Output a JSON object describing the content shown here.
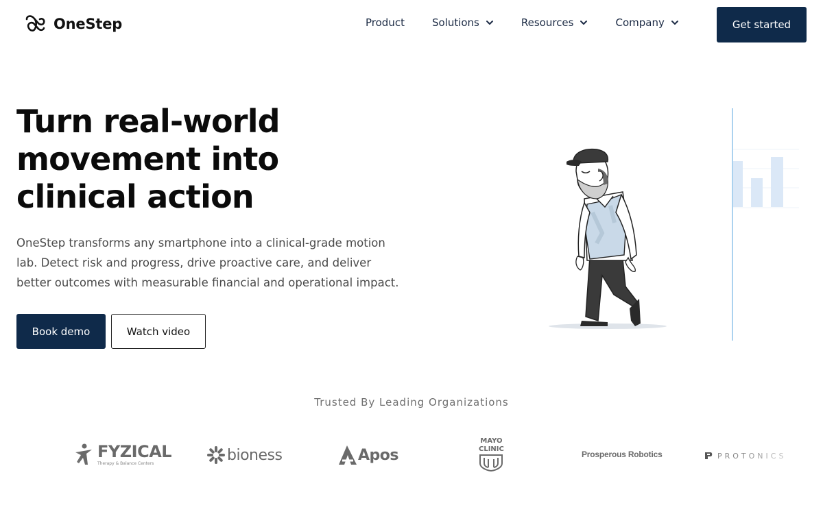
{
  "brand": {
    "name": "OneStep"
  },
  "nav": {
    "links": [
      {
        "label": "Product",
        "has_dropdown": false
      },
      {
        "label": "Solutions",
        "has_dropdown": true
      },
      {
        "label": "Resources",
        "has_dropdown": true
      },
      {
        "label": "Company",
        "has_dropdown": true
      }
    ],
    "cta_label": "Get started"
  },
  "hero": {
    "title_lines": [
      "Turn real-world",
      "movement into",
      "clinical action"
    ],
    "description": "OneStep transforms any smartphone into a clinical-grade motion lab. Detect risk and progress, drive proactive care, and deliver better outcomes with measurable financial and operational impact.",
    "primary_button": "Book demo",
    "secondary_button": "Watch video"
  },
  "trusted": {
    "heading": "Trusted By Leading Organizations",
    "logos": [
      {
        "name": "FYZICAL",
        "subtext": "Therapy & Balance Centers"
      },
      {
        "name": "bioness"
      },
      {
        "name": "Apos"
      },
      {
        "name": "MAYO CLINIC",
        "lines": [
          "MAYO",
          "CLINIC"
        ]
      },
      {
        "name": "Prosperous Robotics"
      },
      {
        "name": "PROTONICS"
      }
    ]
  },
  "colors": {
    "primary": "#0f2a4a",
    "text_dark": "#0b0b0b",
    "text_muted": "#4a4a4a",
    "chart_bar": "#dbe8f7",
    "chart_line": "#8fc3ea"
  },
  "icons": [
    "onestep-logo-icon",
    "chevron-down-icon",
    "fyzical-logo-icon",
    "bioness-logo-icon",
    "apos-logo-icon",
    "mayo-shield-icon",
    "protonics-logo-icon"
  ]
}
